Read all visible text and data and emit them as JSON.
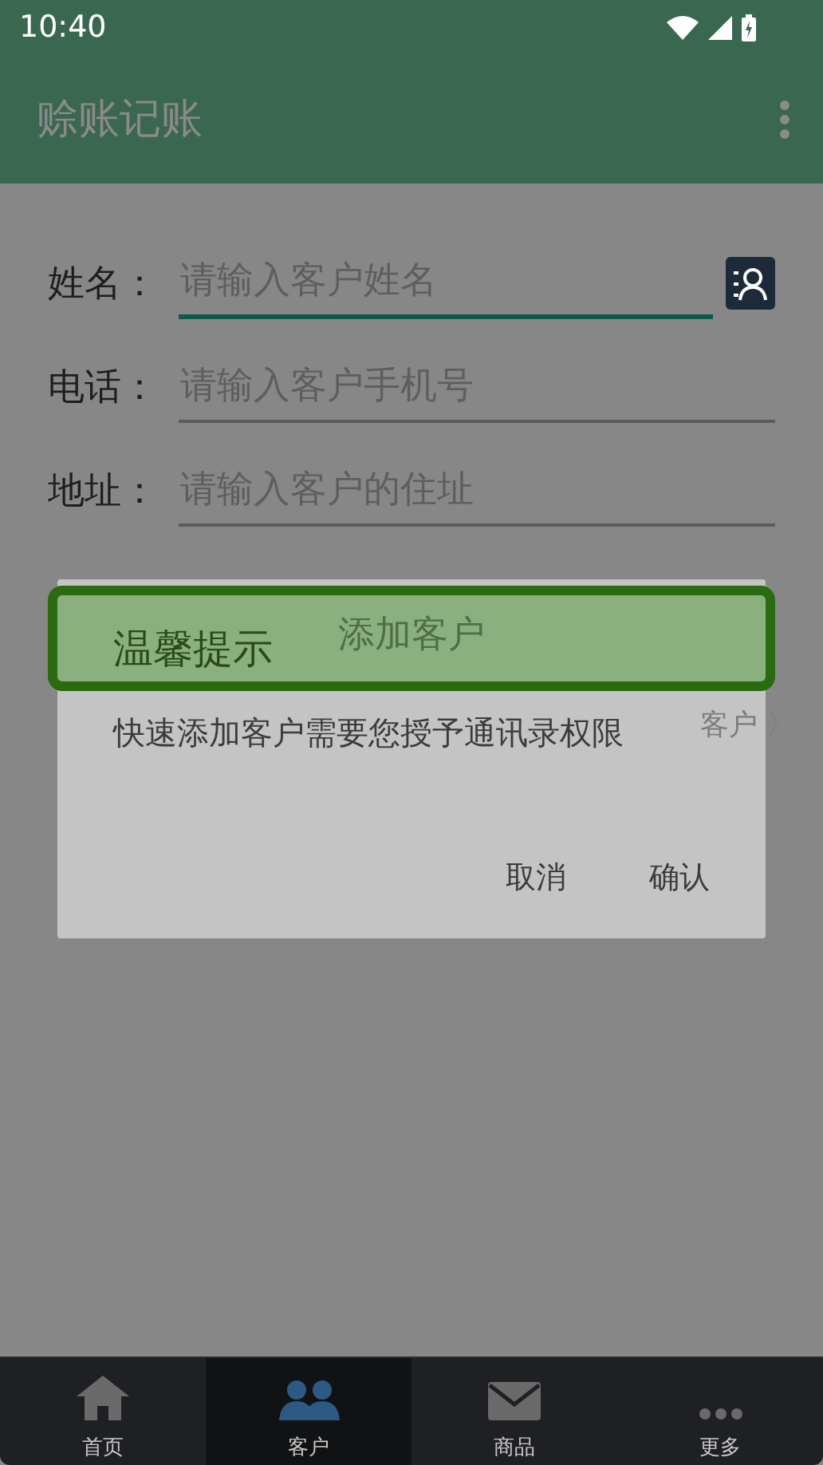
{
  "status_bar": {
    "time": "10:40"
  },
  "app_bar": {
    "title": "赊账记账"
  },
  "form": {
    "fields": [
      {
        "label": "姓名：",
        "placeholder": "请输入客户姓名",
        "focused": true,
        "has_contact_button": true
      },
      {
        "label": "电话：",
        "placeholder": "请输入客户手机号",
        "focused": false,
        "has_contact_button": false
      },
      {
        "label": "地址：",
        "placeholder": "请输入客户的住址",
        "focused": false,
        "has_contact_button": false
      }
    ],
    "add_button": "添加客户",
    "behind_link": "客户 〉"
  },
  "dialog": {
    "title": "温馨提示",
    "message": "快速添加客户需要您授予通讯录权限",
    "buttons": [
      "取消",
      "确认"
    ]
  },
  "bottom_nav": [
    {
      "label": "首页",
      "kind": "home",
      "selected": false
    },
    {
      "label": "客户",
      "kind": "people",
      "selected": true
    },
    {
      "label": "商品",
      "kind": "mail",
      "selected": false
    },
    {
      "label": "更多",
      "kind": "more",
      "selected": false
    }
  ]
}
